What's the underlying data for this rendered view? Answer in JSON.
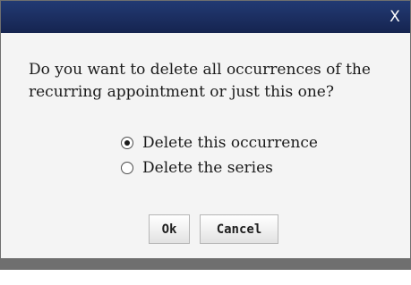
{
  "dialog": {
    "close_label": "X",
    "message_line1": "Do you want to delete all occurrences of the",
    "message_line2": "recurring appointment or just this one?",
    "options": [
      {
        "label": "Delete this occurrence",
        "selected": true
      },
      {
        "label": "Delete the series",
        "selected": false
      }
    ],
    "buttons": {
      "ok": "Ok",
      "cancel": "Cancel"
    }
  }
}
